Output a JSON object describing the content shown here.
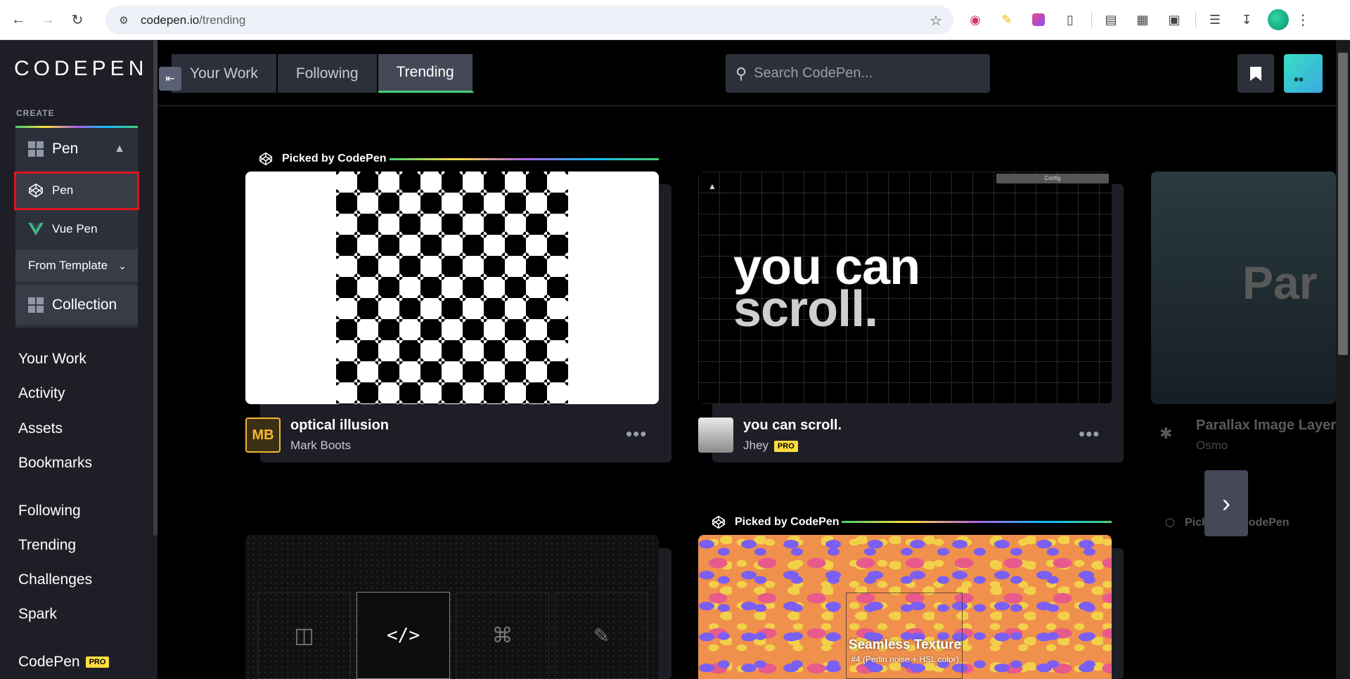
{
  "browser": {
    "url_host": "codepen.io",
    "url_path": "/trending"
  },
  "sidebar": {
    "logo": "CODEPEN",
    "create_label": "CREATE",
    "pen_toggle_label": "Pen",
    "submenu": {
      "pen": "Pen",
      "vue_pen": "Vue Pen",
      "from_template": "From Template",
      "collection": "Collection"
    },
    "links": [
      "Your Work",
      "Activity",
      "Assets",
      "Bookmarks",
      "Following",
      "Trending",
      "Challenges",
      "Spark"
    ],
    "codepen_pro": "CodePen",
    "pro_badge": "PRO"
  },
  "header": {
    "tabs": [
      "Your Work",
      "Following",
      "Trending"
    ],
    "active_tab": "Trending",
    "search_placeholder": "Search CodePen..."
  },
  "cards": [
    {
      "picked_label": "Picked by CodePen",
      "title": "optical illusion",
      "author": "Mark Boots",
      "avatar_text": "MB"
    },
    {
      "title": "you can scroll.",
      "author": "Jhey",
      "author_badge": "PRO",
      "preview_text_1": "you can",
      "preview_text_2": "scroll.",
      "config_label": "Config"
    },
    {
      "title": "Parallax Image Layer",
      "author": "Osmo",
      "preview_text": "Par"
    },
    {
      "picked_label": "Picked by CodePen",
      "preview_title": "Seamless Texture",
      "preview_subtitle": "#4 (Perlin noise + HSL color)"
    },
    {
      "picked_label": "Picked by CodePen"
    }
  ],
  "colors": {
    "accent_green": "#47cf73",
    "pro_yellow": "#ffdd40",
    "highlight_red": "#e0161e",
    "sidebar_bg": "#1e1f26"
  }
}
